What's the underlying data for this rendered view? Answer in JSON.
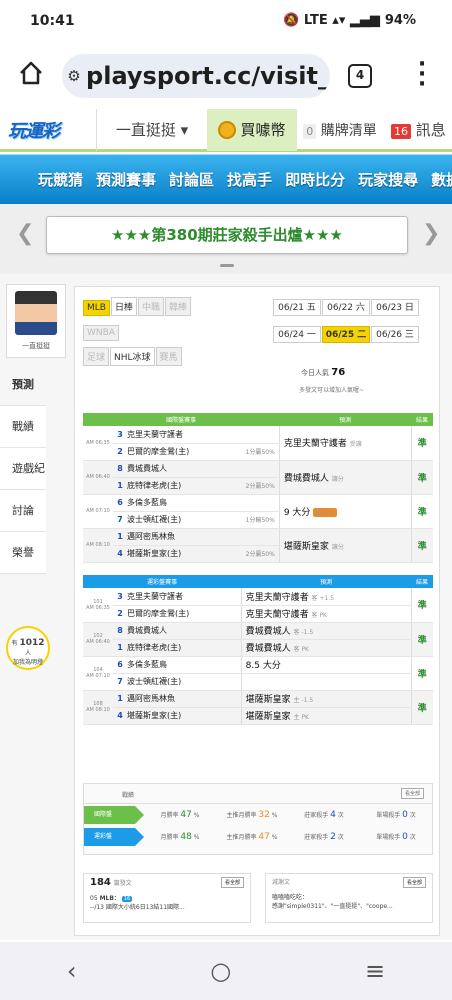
{
  "status": {
    "time": "10:41",
    "battery": "94%",
    "signal_icons": "🔕 LTE ▴▾ ▂▄▆"
  },
  "browser": {
    "url": "playsport.cc/visit_",
    "tab_count": "4"
  },
  "topnav": {
    "logo": "玩運彩",
    "user": "一直挺挺 ▾",
    "buy": "買噱幣",
    "cart_count": "0",
    "cart": "購牌清單",
    "msg_count": "16",
    "msg": "訊息"
  },
  "mainnav": [
    "玩競猜",
    "預測賽事",
    "討論區",
    "找高手",
    "即時比分",
    "玩家搜尋",
    "數據"
  ],
  "banner": {
    "text": "★★★第380期莊家殺手出爐★★★"
  },
  "profile": {
    "name": "一直挺挺"
  },
  "sidebar": [
    "預測",
    "戰績",
    "遊戲紀錄",
    "討論",
    "榮譽"
  ],
  "fans": {
    "pre": "有",
    "count": "1012",
    "post": "人",
    "line2": "加我為明燈"
  },
  "leagues": [
    {
      "n": "MLB",
      "s": "on"
    },
    {
      "n": "日棒",
      "s": ""
    },
    {
      "n": "中職",
      "s": "off"
    },
    {
      "n": "韓棒",
      "s": "off"
    },
    {
      "n": "WNBA",
      "s": "off"
    },
    {
      "n": "足球",
      "s": "off"
    },
    {
      "n": "NHL冰球",
      "s": ""
    },
    {
      "n": "賽馬",
      "s": "off"
    }
  ],
  "dates": [
    {
      "d": "06/21 五",
      "s": ""
    },
    {
      "d": "06/22 六",
      "s": ""
    },
    {
      "d": "06/23 日",
      "s": ""
    },
    {
      "d": "06/24 一",
      "s": ""
    },
    {
      "d": "06/25 二",
      "s": "on"
    },
    {
      "d": "06/26 三",
      "s": ""
    }
  ],
  "popularity": {
    "label": "今日人氣",
    "value": "76"
  },
  "note": "多發文可以增加人氣喔~",
  "intl": {
    "headers": [
      "國際盤賽事",
      "預測",
      "結果"
    ],
    "games": [
      {
        "time": "AM 06:35",
        "a": {
          "n": "3",
          "t": "克里夫蘭守護者"
        },
        "b": {
          "n": "2",
          "t": "巴爾的摩金鶯(主)"
        },
        "res": "1分贏50%",
        "pred": "克里夫蘭守護者",
        "extra": "受讓",
        "ok": "準"
      },
      {
        "time": "AM 06:40",
        "a": {
          "n": "8",
          "t": "費城費城人"
        },
        "b": {
          "n": "1",
          "t": "底特律老虎(主)"
        },
        "res": "2分贏50%",
        "pred": "費城費城人",
        "extra": "讓分",
        "ok": "準"
      },
      {
        "time": "AM 07:10",
        "a": {
          "n": "6",
          "t": "多倫多藍鳥"
        },
        "b": {
          "n": "7",
          "t": "波士頓紅襪(主)"
        },
        "res": "1分輸50%",
        "pred": "9 大分",
        "extra": "贏50%",
        "ok": "準"
      },
      {
        "time": "AM 08:10",
        "a": {
          "n": "1",
          "t": "邁阿密馬林魚"
        },
        "b": {
          "n": "4",
          "t": "堪薩斯皇家(主)"
        },
        "res": "2分贏50%",
        "pred": "堪薩斯皇家",
        "extra": "讓分",
        "ok": "準"
      }
    ]
  },
  "taiwan": {
    "headers": [
      "運彩盤賽事",
      "預測",
      "結果"
    ],
    "games": [
      {
        "id": "101",
        "time": "AM 06:35",
        "a": {
          "n": "3",
          "t": "克里夫蘭守護者"
        },
        "b": {
          "n": "2",
          "t": "巴爾的摩金鶯(主)"
        },
        "p1": "克里夫蘭守護者",
        "e1": "客 +1.5",
        "p2": "克里夫蘭守護者",
        "e2": "客 PK",
        "ok": "準"
      },
      {
        "id": "102",
        "time": "AM 06:40",
        "a": {
          "n": "8",
          "t": "費城費城人"
        },
        "b": {
          "n": "1",
          "t": "底特律老虎(主)"
        },
        "p1": "費城費城人",
        "e1": "客 -1.5",
        "p2": "費城費城人",
        "e2": "客 PK",
        "ok": "準"
      },
      {
        "id": "104",
        "time": "AM 07:10",
        "a": {
          "n": "6",
          "t": "多倫多藍鳥"
        },
        "b": {
          "n": "7",
          "t": "波士頓紅襪(主)"
        },
        "p1": "8.5 大分",
        "e1": "",
        "p2": "",
        "e2": "",
        "ok": "準"
      },
      {
        "id": "108",
        "time": "AM 08:10",
        "a": {
          "n": "1",
          "t": "邁阿密馬林魚"
        },
        "b": {
          "n": "4",
          "t": "堪薩斯皇家(主)"
        },
        "p1": "堪薩斯皇家",
        "e1": "主 -1.5",
        "p2": "堪薩斯皇家",
        "e2": "主 PK",
        "ok": "準"
      }
    ]
  },
  "stats": {
    "title": "戰績",
    "btn": "看全部",
    "rows": [
      {
        "label": "國際盤",
        "color": "#6cc04a",
        "month": "47",
        "main": "32",
        "rank1": "4",
        "rank2": "0"
      },
      {
        "label": "運彩盤",
        "color": "#1c9ce6",
        "month": "48",
        "main": "47",
        "rank1": "2",
        "rank2": "0"
      }
    ],
    "month_label": "月勝率",
    "main_label": "主推月勝率",
    "rank1_label": "莊家殺手",
    "rank2_label": "單場殺手",
    "unit": "次",
    "pct": "%"
  },
  "posts": {
    "count": "184",
    "label": "篇發文",
    "btn": "看全部",
    "date": "05",
    "sub": "--/13",
    "title": "MLB：",
    "desc": "國際大小統6日13結11國際...",
    "badge": "16"
  },
  "replies": {
    "label": "減謝文",
    "btn": "看全部",
    "user": "嗑嗑嗑吃吃：",
    "desc": "感謝\"simple0311\"、\"一直挺挺\"、\"coope..."
  },
  "android": [
    "‹",
    "○",
    "≡"
  ]
}
